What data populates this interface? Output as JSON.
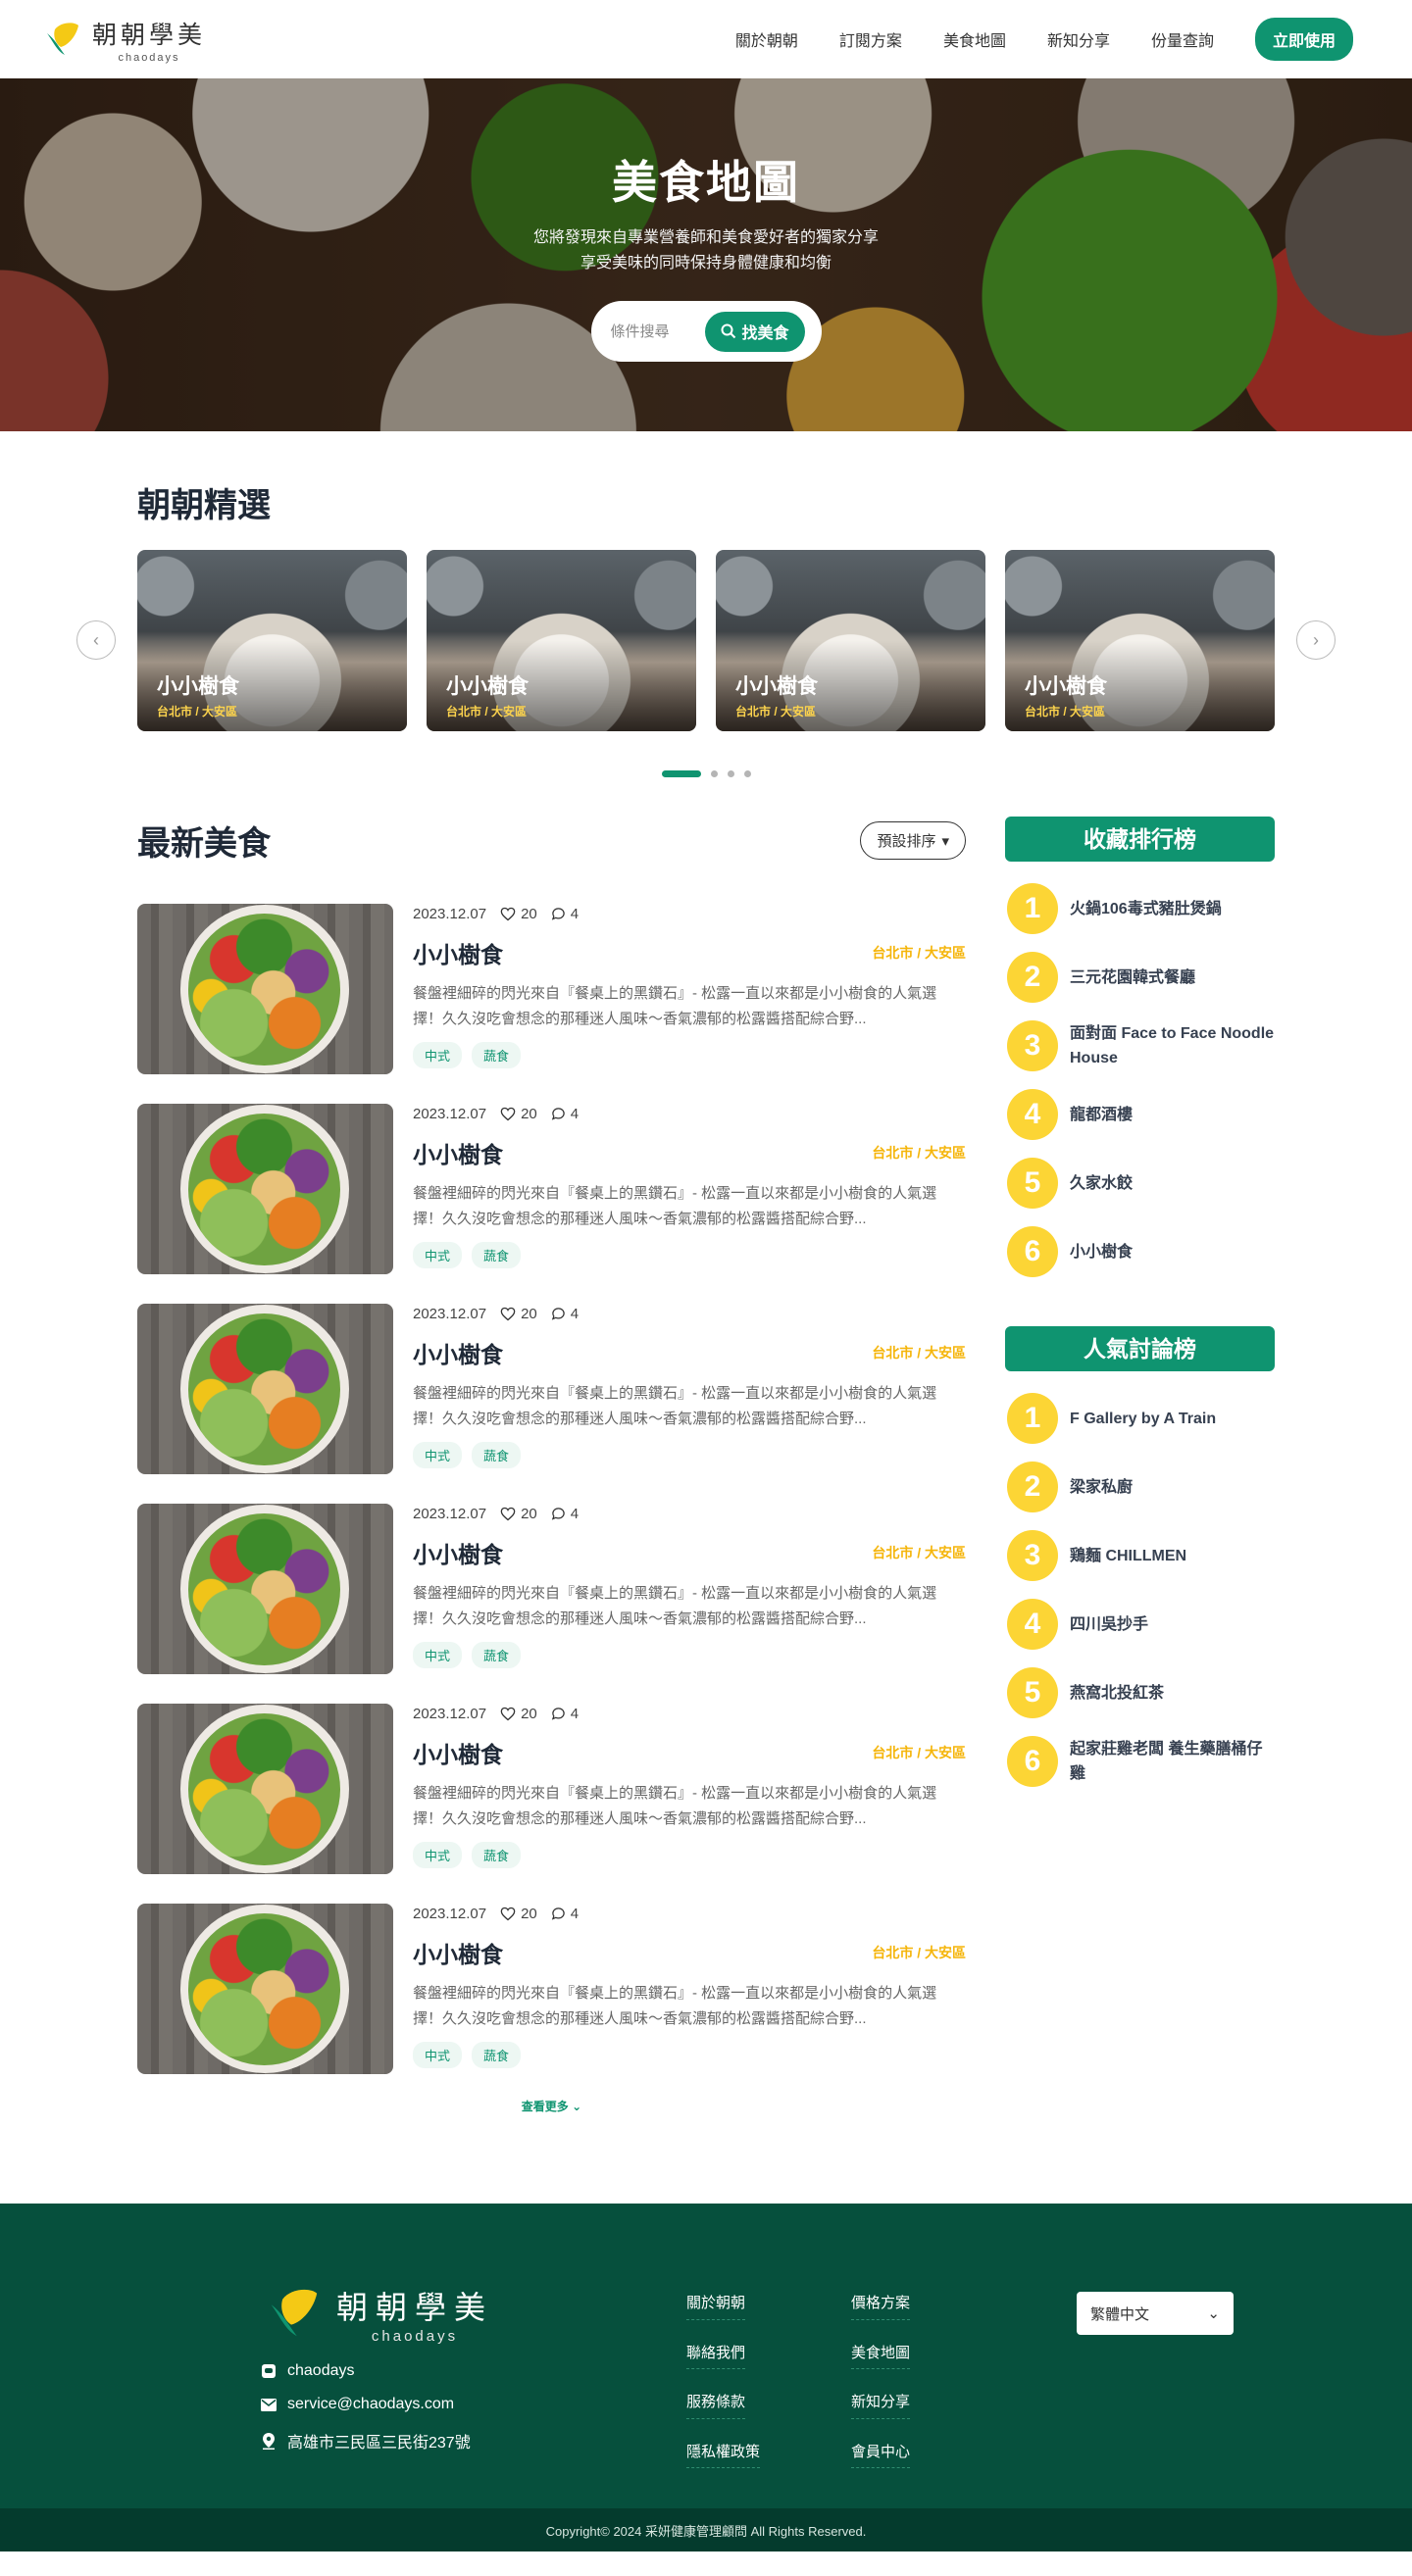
{
  "brand": {
    "name_cn": "朝朝學美",
    "name_en": "chaodays"
  },
  "nav": {
    "items": [
      "關於朝朝",
      "訂閱方案",
      "美食地圖",
      "新知分享",
      "份量查詢"
    ],
    "cta": "立即使用"
  },
  "hero": {
    "title": "美食地圖",
    "subtitle_line1": "您將發現來自專業營養師和美食愛好者的獨家分享",
    "subtitle_line2": "享受美味的同時保持身體健康和均衡",
    "search_placeholder": "條件搜尋",
    "search_button": "找美食"
  },
  "featured": {
    "title": "朝朝精選",
    "cards": [
      {
        "name": "小小樹食",
        "location": "台北市 / 大安區"
      },
      {
        "name": "小小樹食",
        "location": "台北市 / 大安區"
      },
      {
        "name": "小小樹食",
        "location": "台北市 / 大安區"
      },
      {
        "name": "小小樹食",
        "location": "台北市 / 大安區"
      }
    ],
    "dots": 4,
    "active_dot": 1
  },
  "latest": {
    "title": "最新美食",
    "sort_label": "預設排序",
    "posts": [
      {
        "date": "2023.12.07",
        "likes": "20",
        "comments": "4",
        "title": "小小樹食",
        "location": "台北市 / 大安區",
        "desc": "餐盤裡細碎的閃光來自『餐桌上的黑鑽石』- 松露一直以來都是小小樹食的人氣選擇！久久沒吃會想念的那種迷人風味～香氣濃郁的松露醬搭配綜合野...",
        "tags": [
          "中式",
          "蔬食"
        ]
      },
      {
        "date": "2023.12.07",
        "likes": "20",
        "comments": "4",
        "title": "小小樹食",
        "location": "台北市 / 大安區",
        "desc": "餐盤裡細碎的閃光來自『餐桌上的黑鑽石』- 松露一直以來都是小小樹食的人氣選擇！久久沒吃會想念的那種迷人風味～香氣濃郁的松露醬搭配綜合野...",
        "tags": [
          "中式",
          "蔬食"
        ]
      },
      {
        "date": "2023.12.07",
        "likes": "20",
        "comments": "4",
        "title": "小小樹食",
        "location": "台北市 / 大安區",
        "desc": "餐盤裡細碎的閃光來自『餐桌上的黑鑽石』- 松露一直以來都是小小樹食的人氣選擇！久久沒吃會想念的那種迷人風味～香氣濃郁的松露醬搭配綜合野...",
        "tags": [
          "中式",
          "蔬食"
        ]
      },
      {
        "date": "2023.12.07",
        "likes": "20",
        "comments": "4",
        "title": "小小樹食",
        "location": "台北市 / 大安區",
        "desc": "餐盤裡細碎的閃光來自『餐桌上的黑鑽石』- 松露一直以來都是小小樹食的人氣選擇！久久沒吃會想念的那種迷人風味～香氣濃郁的松露醬搭配綜合野...",
        "tags": [
          "中式",
          "蔬食"
        ]
      },
      {
        "date": "2023.12.07",
        "likes": "20",
        "comments": "4",
        "title": "小小樹食",
        "location": "台北市 / 大安區",
        "desc": "餐盤裡細碎的閃光來自『餐桌上的黑鑽石』- 松露一直以來都是小小樹食的人氣選擇！久久沒吃會想念的那種迷人風味～香氣濃郁的松露醬搭配綜合野...",
        "tags": [
          "中式",
          "蔬食"
        ]
      },
      {
        "date": "2023.12.07",
        "likes": "20",
        "comments": "4",
        "title": "小小樹食",
        "location": "台北市 / 大安區",
        "desc": "餐盤裡細碎的閃光來自『餐桌上的黑鑽石』- 松露一直以來都是小小樹食的人氣選擇！久久沒吃會想念的那種迷人風味～香氣濃郁的松露醬搭配綜合野...",
        "tags": [
          "中式",
          "蔬食"
        ]
      }
    ],
    "more_label": "查看更多"
  },
  "rankings": [
    {
      "title": "收藏排行榜",
      "items": [
        "火鍋106毒式豬肚煲鍋",
        "三元花園韓式餐廳",
        "面對面 Face to Face Noodle House",
        "龍都酒樓",
        "久家水餃",
        "小小樹食"
      ]
    },
    {
      "title": "人氣討論榜",
      "items": [
        "F Gallery by A Train",
        "梁家私廚",
        "鶏麵 CHILLMEN",
        "四川吳抄手",
        "燕窩北投紅茶",
        "起家莊雞老闆 養生藥膳桶仔雞"
      ]
    }
  ],
  "footer": {
    "contacts": [
      {
        "icon": "line-icon",
        "text": "chaodays"
      },
      {
        "icon": "mail-icon",
        "text": "service@chaodays.com"
      },
      {
        "icon": "location-icon",
        "text": "高雄市三民區三民街237號"
      }
    ],
    "links": [
      "關於朝朝",
      "價格方案",
      "聯絡我們",
      "美食地圖",
      "服務條款",
      "新知分享",
      "隱私權政策",
      "會員中心"
    ],
    "language": "繁體中文",
    "copyright": "Copyright© 2024 采妍健康管理顧問 All Rights Reserved."
  },
  "colors": {
    "primary": "#0f9470",
    "accent_yellow": "#fcd535",
    "footer_bg": "#06503d"
  }
}
